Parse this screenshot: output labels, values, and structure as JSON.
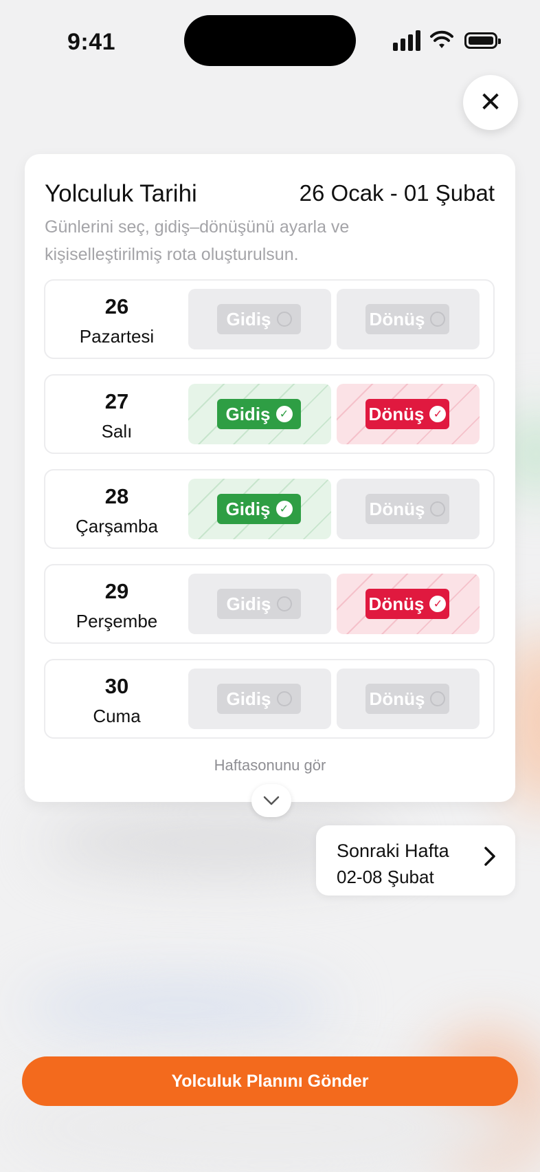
{
  "status_bar": {
    "time": "9:41"
  },
  "close_icon": "✕",
  "card": {
    "title": "Yolculuk Tarihi",
    "range": "26 Ocak - 01 Şubat",
    "description": "Günlerini seç, gidiş–dönüşünü ayarla ve kişiselleştirilmiş rota oluşturulsun.",
    "days": [
      {
        "num": "26",
        "name": "Pazartesi",
        "go": {
          "label": "Gidiş",
          "selected": false
        },
        "ret": {
          "label": "Dönüş",
          "selected": false
        }
      },
      {
        "num": "27",
        "name": "Salı",
        "go": {
          "label": "Gidiş",
          "selected": true
        },
        "ret": {
          "label": "Dönüş",
          "selected": true
        }
      },
      {
        "num": "28",
        "name": "Çarşamba",
        "go": {
          "label": "Gidiş",
          "selected": true
        },
        "ret": {
          "label": "Dönüş",
          "selected": false
        }
      },
      {
        "num": "29",
        "name": "Perşembe",
        "go": {
          "label": "Gidiş",
          "selected": false
        },
        "ret": {
          "label": "Dönüş",
          "selected": true
        }
      },
      {
        "num": "30",
        "name": "Cuma",
        "go": {
          "label": "Gidiş",
          "selected": false
        },
        "ret": {
          "label": "Dönüş",
          "selected": false
        }
      }
    ],
    "weekend_label": "Haftasonunu gör"
  },
  "next_week": {
    "title": "Sonraki Hafta",
    "range": "02-08 Şubat"
  },
  "send_button": "Yolculuk Planını Gönder",
  "colors": {
    "accent": "#f36a1d",
    "go_active": "#2e9e44",
    "return_active": "#e0193f"
  },
  "icons": {
    "close": "close-icon",
    "check": "check-icon",
    "chevron_down": "chevron-down-icon",
    "chevron_right": "chevron-right-icon"
  }
}
